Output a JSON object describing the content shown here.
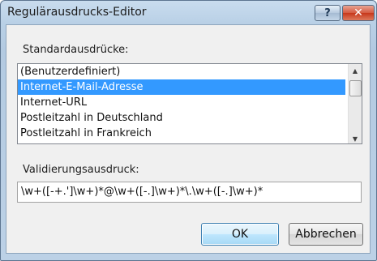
{
  "window": {
    "title": "Regulärausdrucks-Editor",
    "help_label": "?",
    "close_label": "✕"
  },
  "standard": {
    "label": "Standardausdrücke:",
    "items": [
      {
        "label": "(Benutzerdefiniert)",
        "selected": false
      },
      {
        "label": "Internet-E-Mail-Adresse",
        "selected": true
      },
      {
        "label": "Internet-URL",
        "selected": false
      },
      {
        "label": "Postleitzahl in Deutschland",
        "selected": false
      },
      {
        "label": "Postleitzahl in Frankreich",
        "selected": false
      }
    ]
  },
  "validation": {
    "label": "Validierungsausdruck:",
    "value": "\\w+([-+.']\\w+)*@\\w+([-.]\\w+)*\\.\\w+([-.]\\w+)*"
  },
  "buttons": {
    "ok": "OK",
    "cancel": "Abbrechen"
  },
  "colors": {
    "selection": "#3399ff",
    "title_gradient": "#c9dcee",
    "close_button": "#c7371b"
  }
}
